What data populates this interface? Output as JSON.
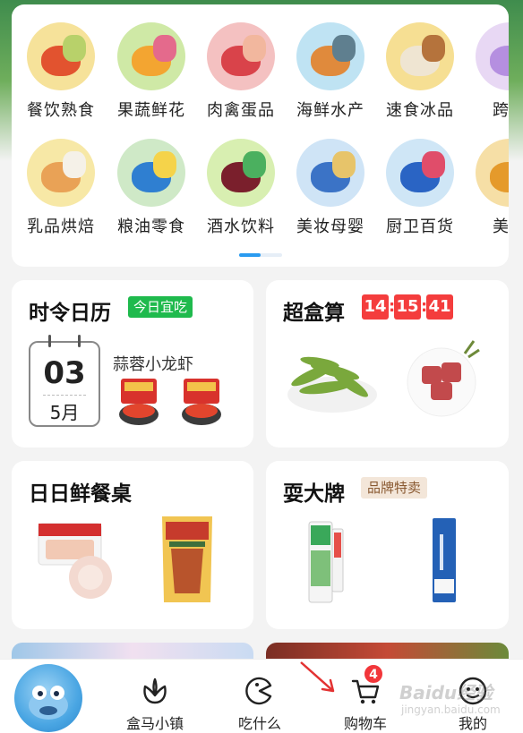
{
  "categories": {
    "row1": [
      {
        "label": "餐饮熟食",
        "icon": "crayfish-icon",
        "bg": "#f6e29a",
        "c1": "#e2532f",
        "c2": "#b8d16a"
      },
      {
        "label": "果蔬鲜花",
        "icon": "fruit-icon",
        "bg": "#cfe9a6",
        "c1": "#f3a531",
        "c2": "#e46a8c"
      },
      {
        "label": "肉禽蛋品",
        "icon": "meat-icon",
        "bg": "#f4c1c1",
        "c1": "#d9434a",
        "c2": "#f2b79e"
      },
      {
        "label": "海鲜水产",
        "icon": "seafood-icon",
        "bg": "#bfe3f3",
        "c1": "#e08a3c",
        "c2": "#5f7f8f"
      },
      {
        "label": "速食冰品",
        "icon": "dumpling-icon",
        "bg": "#f6df93",
        "c1": "#efe5d2",
        "c2": "#b5733c"
      },
      {
        "label": "跨境",
        "icon": "crossborder-icon",
        "bg": "#e8d8f4",
        "c1": "#b58fe0",
        "c2": "#ffffff"
      }
    ],
    "row2": [
      {
        "label": "乳品烘焙",
        "icon": "dairy-icon",
        "bg": "#f7e8a6",
        "c1": "#e9a256",
        "c2": "#f5f1e8"
      },
      {
        "label": "粮油零食",
        "icon": "grain-oil-icon",
        "bg": "#cfe9c7",
        "c1": "#2f7fd1",
        "c2": "#f5d34a"
      },
      {
        "label": "酒水饮料",
        "icon": "drinks-icon",
        "bg": "#d8efb1",
        "c1": "#7a1f2c",
        "c2": "#4bb05f"
      },
      {
        "label": "美妆母婴",
        "icon": "beauty-baby-icon",
        "bg": "#cfe4f6",
        "c1": "#3b73c6",
        "c2": "#e7c46a"
      },
      {
        "label": "厨卫百货",
        "icon": "household-icon",
        "bg": "#cfe6f6",
        "c1": "#2a64c4",
        "c2": "#e04d6a"
      },
      {
        "label": "美味",
        "icon": "delicacy-icon",
        "bg": "#f6dfa6",
        "c1": "#e59a2b",
        "c2": "#c2452f"
      }
    ]
  },
  "calendar_card": {
    "title": "时令日历",
    "tag": "今日宜吃",
    "day": "03",
    "month": "5月",
    "dish": "蒜蓉小龙虾"
  },
  "deal_card": {
    "title": "超盒算",
    "timer": {
      "h": "14",
      "m": "15",
      "s": "41"
    }
  },
  "table_card": {
    "title": "日日鲜餐桌"
  },
  "brand_card": {
    "title": "耍大牌",
    "tag": "品牌特卖"
  },
  "tabbar": {
    "tabs": [
      {
        "label": "盒马小镇",
        "icon": "lotus-icon"
      },
      {
        "label": "吃什么",
        "icon": "eat-icon"
      },
      {
        "label": "购物车",
        "icon": "cart-icon",
        "badge": "4"
      },
      {
        "label": "我的",
        "icon": "profile-icon"
      }
    ]
  },
  "watermark": {
    "text": "Baidu经验",
    "sub": "jingyan.baidu.com"
  }
}
